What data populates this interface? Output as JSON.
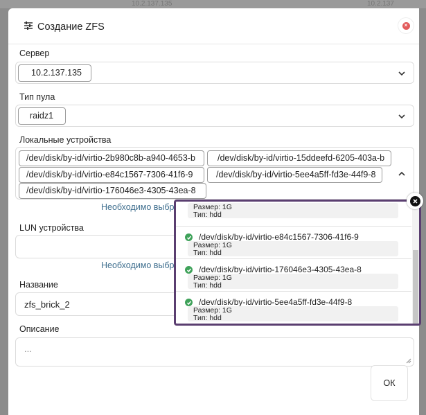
{
  "background": {
    "ip_fragment_left": "10.2.137.135",
    "ip_fragment_right": "10.2.137"
  },
  "dialog": {
    "title": "Создание ZFS",
    "title_icon": "sliders-icon",
    "close_icon": "close-icon",
    "accent_close": "#e25b5b",
    "server": {
      "label": "Сервер",
      "value": "10.2.137.135"
    },
    "pool_type": {
      "label": "Тип пула",
      "value": "raidz1"
    },
    "local_devices": {
      "label": "Локальные устройства",
      "chips": [
        "/dev/disk/by-id/virtio-2b980c8b-a940-4653-b",
        "/dev/disk/by-id/virtio-15ddeefd-6205-403a-b",
        "/dev/disk/by-id/virtio-e84c1567-7306-41f6-9",
        "/dev/disk/by-id/virtio-5ee4a5ff-fd3e-44f9-8",
        "/dev/disk/by-id/virtio-176046e3-4305-43ea-8"
      ],
      "hint": "Необходимо выбр"
    },
    "lun_devices": {
      "label": "LUN устройства",
      "hint": "Необходимо выбр"
    },
    "name": {
      "label": "Название",
      "value": "zfs_brick_2"
    },
    "description": {
      "label": "Описание",
      "placeholder": "..."
    },
    "ok_label": "ОК"
  },
  "popup": {
    "border_color": "#5a3e70",
    "check_color": "#3fa25a",
    "items": [
      {
        "path": "",
        "size": "Размер: 1G",
        "type": "Тип: hdd"
      },
      {
        "path": "/dev/disk/by-id/virtio-e84c1567-7306-41f6-9",
        "size": "Размер: 1G",
        "type": "Тип: hdd"
      },
      {
        "path": "/dev/disk/by-id/virtio-176046e3-4305-43ea-8",
        "size": "Размер: 1G",
        "type": "Тип: hdd"
      },
      {
        "path": "/dev/disk/by-id/virtio-5ee4a5ff-fd3e-44f9-8",
        "size": "Размер: 1G",
        "type": "Тип: hdd"
      }
    ]
  }
}
